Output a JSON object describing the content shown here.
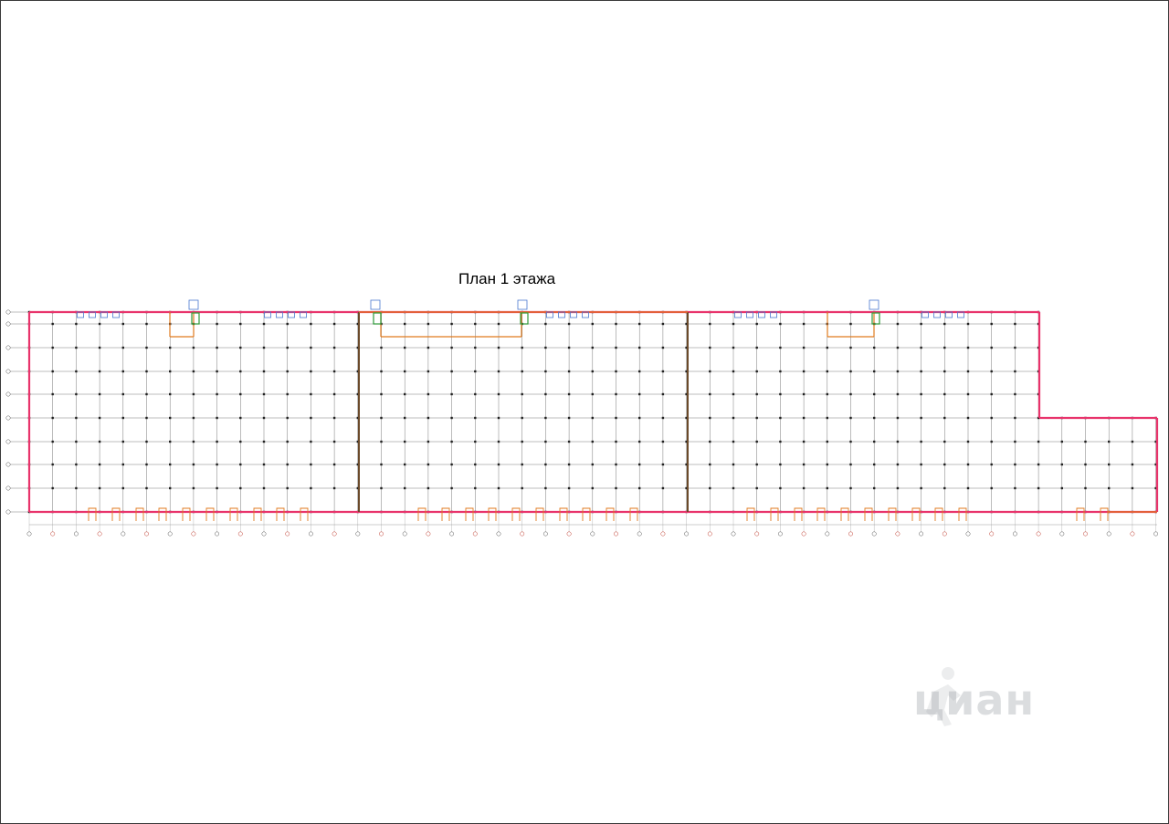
{
  "drawing": {
    "title": "План 1 этажа"
  },
  "watermark": {
    "text": "циан",
    "icon": "person-icon"
  },
  "colors": {
    "outer_wall": "#e8336b",
    "inner_wall": "#e07a1e",
    "grid_line": "#7a7a7a",
    "column": "#222222",
    "fixture": "#4a78d0",
    "stair": "#2e9a3a",
    "axis_bubble": "#c0392b"
  }
}
